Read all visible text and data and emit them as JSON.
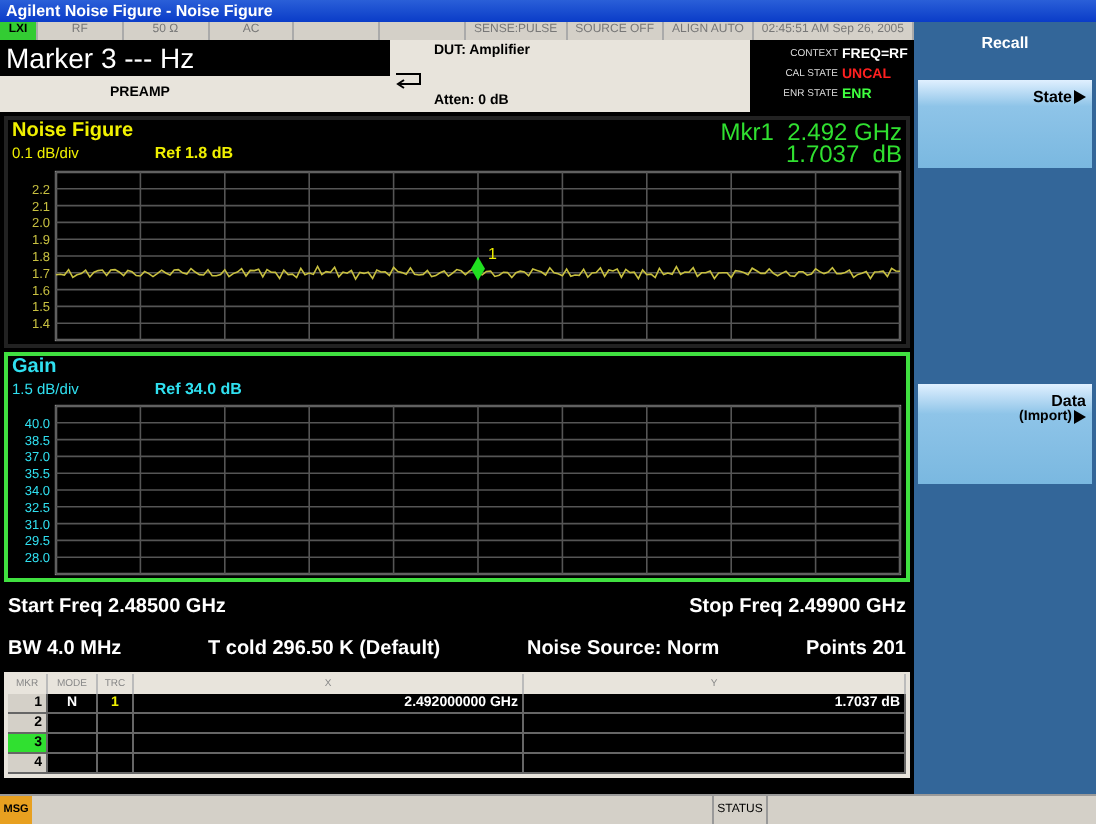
{
  "window": {
    "title": "Agilent Noise Figure - Noise Figure"
  },
  "status_items": [
    "LXI",
    "RF",
    "50 Ω",
    "AC",
    "SENSE:PULSE",
    "SOURCE OFF",
    "ALIGN AUTO",
    "02:45:51 AM Sep 26, 2005"
  ],
  "marker_header": {
    "title": "Marker 3 --- Hz",
    "preamp": "PREAMP",
    "dut": "DUT: Amplifier",
    "atten": "Atten: 0 dB"
  },
  "context": [
    {
      "label": "CONTEXT",
      "value": "FREQ=RF",
      "color": "#ffffff"
    },
    {
      "label": "CAL STATE",
      "value": "UNCAL",
      "color": "#ff2020"
    },
    {
      "label": "ENR STATE",
      "value": "ENR",
      "color": "#40ff40"
    }
  ],
  "noise_figure": {
    "title": "Noise Figure",
    "scale": "0.1 dB/div",
    "ref": "Ref 1.8 dB",
    "marker_freq": "Mkr1  2.492 GHz",
    "marker_value": "1.7037  dB",
    "marker_label": "1",
    "yticks": [
      "2.2",
      "2.1",
      "2.0",
      "1.9",
      "1.8",
      "1.7",
      "1.6",
      "1.5",
      "1.4"
    ]
  },
  "gain": {
    "title": "Gain",
    "scale": "1.5 dB/div",
    "ref": "Ref 34.0 dB",
    "yticks": [
      "40.0",
      "38.5",
      "37.0",
      "35.5",
      "34.0",
      "32.5",
      "31.0",
      "29.5",
      "28.0"
    ]
  },
  "sweep": {
    "start": "Start Freq 2.48500 GHz",
    "stop": "Stop Freq 2.49900 GHz",
    "bw": "BW 4.0 MHz",
    "tcold": "T cold 296.50 K (Default)",
    "noise_source": "Noise Source: Norm",
    "points": "Points 201"
  },
  "marker_table": {
    "columns": [
      "MKR",
      "MODE",
      "TRC",
      "X",
      "Y"
    ],
    "rows": [
      {
        "mkr": "1",
        "mode": "N",
        "trc": "1",
        "x": "2.492000000 GHz",
        "y": "1.7037 dB",
        "selected": false
      },
      {
        "mkr": "2",
        "selected": false
      },
      {
        "mkr": "3",
        "selected": true
      },
      {
        "mkr": "4",
        "selected": false
      }
    ]
  },
  "softkeys": {
    "title": "Recall",
    "keys": [
      {
        "label": "State"
      },
      {
        "label": "Data",
        "sublabel": "(Import)"
      }
    ]
  },
  "bottom_bar": {
    "msg": "MSG",
    "status": "STATUS"
  }
}
